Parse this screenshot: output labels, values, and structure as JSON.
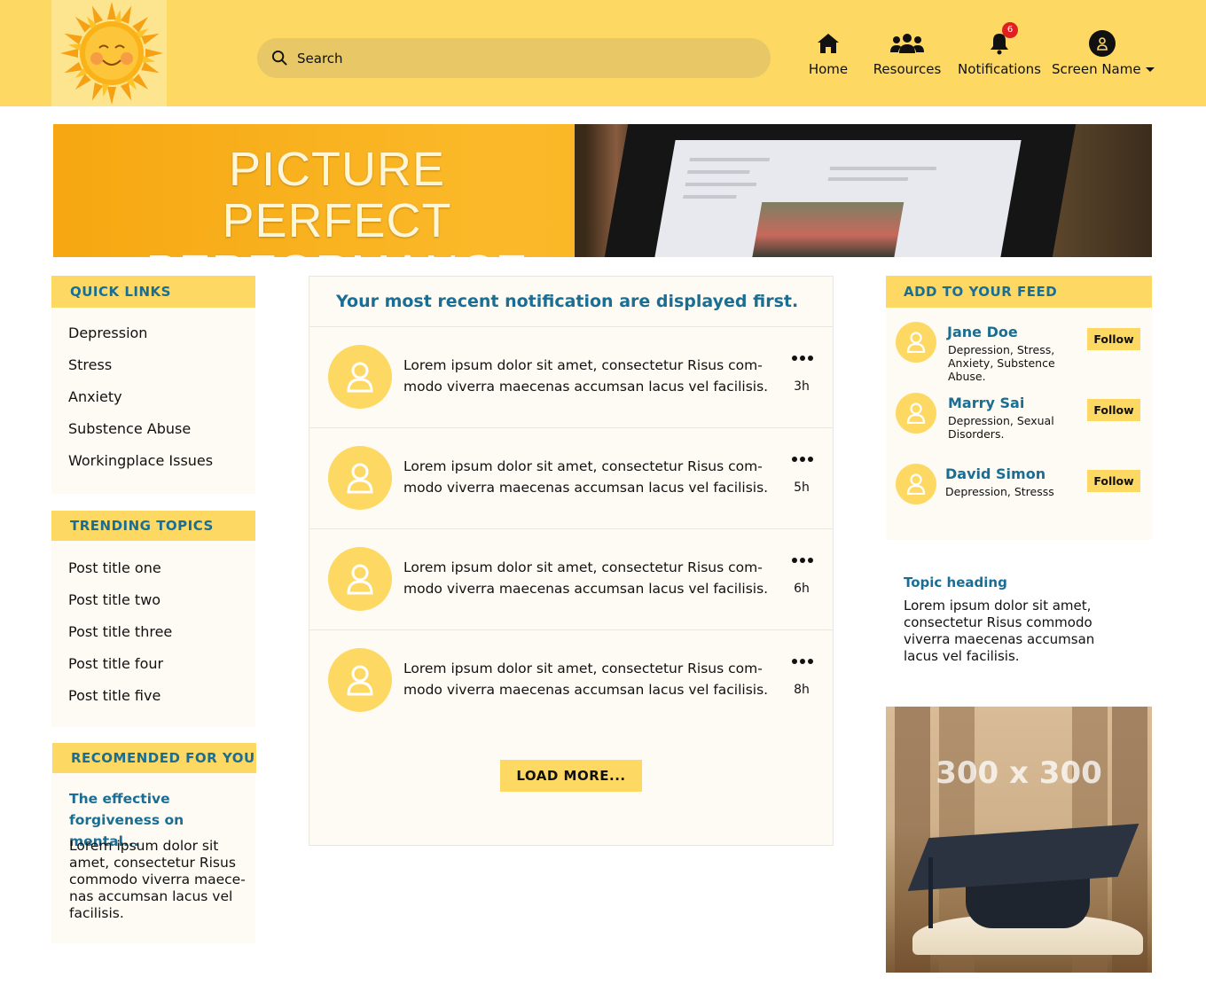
{
  "header": {
    "logo_alt": "sun logo",
    "search": {
      "placeholder": "Search",
      "value": ""
    },
    "nav": [
      {
        "label": "Home",
        "icon": "home-icon"
      },
      {
        "label": "Resources",
        "icon": "users-icon"
      },
      {
        "label": "Notifications",
        "icon": "bell-icon",
        "badge": "6"
      },
      {
        "label": "Screen Name",
        "icon": "user-circle-icon"
      }
    ]
  },
  "banner": {
    "title_line1": "PICTURE PERFECT",
    "title_line2": "PERFORMANCE"
  },
  "quick_links": {
    "heading": "QUICK LINKS",
    "items": [
      "Depression",
      "Stress",
      "Anxiety",
      "Substence Abuse",
      "Workingplace Issues"
    ]
  },
  "trending": {
    "heading": "TRENDING TOPICS",
    "items": [
      "Post title one",
      "Post title two",
      "Post title three",
      "Post title four",
      "Post title five"
    ]
  },
  "recommended": {
    "heading": "RECOMENDED FOR YOU",
    "title": "The effective forgiveness on mental...",
    "body": "Lorem ipsum dolor sit amet, consectetur   Risus commodo viverra maece-nas accumsan lacus vel facilisis."
  },
  "notifications": {
    "title": "Your most recent notification are displayed first.",
    "items": [
      {
        "text": "Lorem ipsum dolor sit amet, consectetur Risus com-modo viverra maecenas accumsan lacus vel facilisis.",
        "time": "3h"
      },
      {
        "text": "Lorem ipsum dolor sit amet, consectetur Risus com-modo viverra maecenas accumsan lacus vel facilisis.",
        "time": "5h"
      },
      {
        "text": "Lorem ipsum dolor sit amet, consectetur Risus com-modo viverra maecenas accumsan lacus vel facilisis.",
        "time": "6h"
      },
      {
        "text": "Lorem ipsum dolor sit amet, consectetur Risus com-modo viverra maecenas accumsan lacus vel facilisis.",
        "time": "8h"
      }
    ],
    "load_more": "LOAD MORE..."
  },
  "feed": {
    "heading": "ADD TO YOUR FEED",
    "people": [
      {
        "name": "Jane Doe",
        "tags": "Depression, Stress, Anxiety, Substence Abuse.",
        "button": "Follow"
      },
      {
        "name": "Marry Sai",
        "tags": "Depression, Sexual Disorders.",
        "button": "Follow"
      },
      {
        "name": "David Simon",
        "tags": "Depression, Stresss",
        "button": "Follow"
      }
    ]
  },
  "topic": {
    "heading": "Topic heading",
    "body": "Lorem ipsum dolor sit amet, consectetur   Risus commodo viverra maecenas accumsan lacus vel facilisis."
  },
  "ad": {
    "label": "300 x 300"
  },
  "colors": {
    "accent": "#fdd863",
    "link": "#1a6e93",
    "card_bg": "#fdfbf3",
    "badge": "#e02020"
  }
}
